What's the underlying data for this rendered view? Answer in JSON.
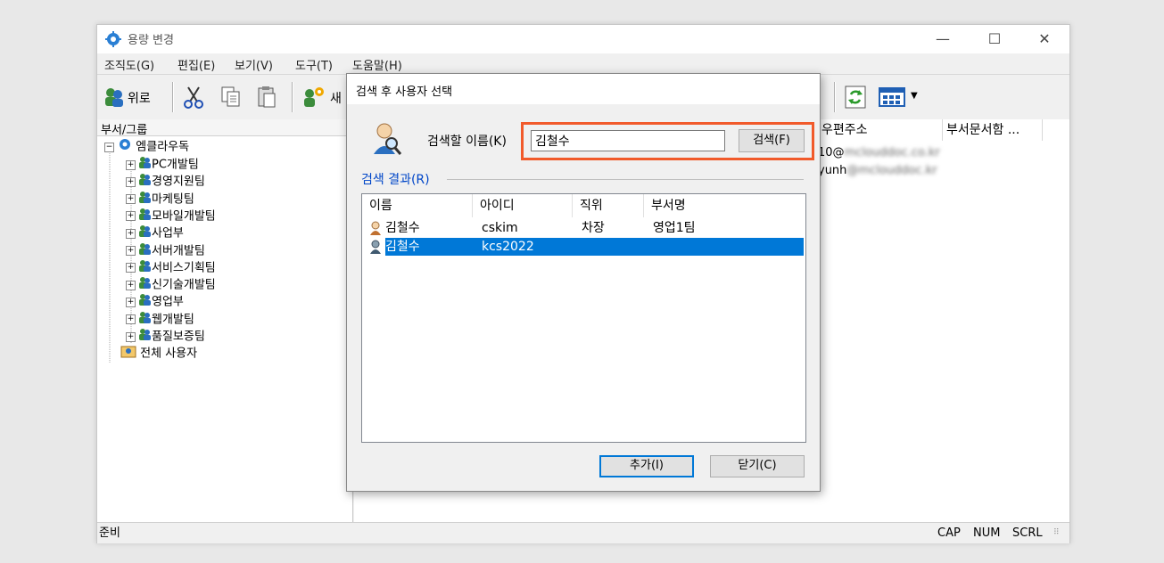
{
  "window": {
    "title": "용량 변경",
    "controls": {
      "minimize": "—",
      "maximize": "☐",
      "close": "✕"
    }
  },
  "menu": [
    "조직도(G)",
    "편집(E)",
    "보기(V)",
    "도구(T)",
    "도움말(H)"
  ],
  "toolbar": {
    "up_label": "위로",
    "new_label": "새"
  },
  "tree": {
    "header": "부서/그룹",
    "root": "엠클라우독",
    "groups": [
      "PC개발팀",
      "경영지원팀",
      "마케팅팀",
      "모바일개발팀",
      "사업부",
      "서버개발팀",
      "서비스기획팀",
      "신기술개발팀",
      "영업부",
      "웹개발팀",
      "품질보증팀"
    ],
    "all_users": "전체 사용자"
  },
  "right_pane": {
    "columns": [
      "우편주소",
      "부서문서함 ..."
    ],
    "rows": [
      {
        "email_visible": "10@",
        "email_blurred": "mclouddoc.co.kr"
      },
      {
        "email_visible": "yunh",
        "email_blurred": "@mclouddoc.kr"
      }
    ]
  },
  "status": {
    "ready": "준비",
    "indicators": [
      "CAP",
      "NUM",
      "SCRL"
    ]
  },
  "dialog": {
    "title": "검색 후 사용자 선택",
    "search_label": "검색할 이름(K)",
    "search_value": "김철수",
    "search_button": "검색(F)",
    "results_label": "검색 결과(R)",
    "columns": [
      "이름",
      "아이디",
      "직위",
      "부서명"
    ],
    "results": [
      {
        "name": "김철수",
        "id": "cskim",
        "position": "차장",
        "dept": "영업1팀",
        "selected": false
      },
      {
        "name": "김철수",
        "id": "kcs2022",
        "position": "",
        "dept": "",
        "selected": true
      }
    ],
    "add_button": "추가(I)",
    "close_button": "닫기(C)"
  },
  "colors": {
    "highlight": "#f15a2b",
    "selection": "#0078d7",
    "group_label": "#0046c8"
  }
}
